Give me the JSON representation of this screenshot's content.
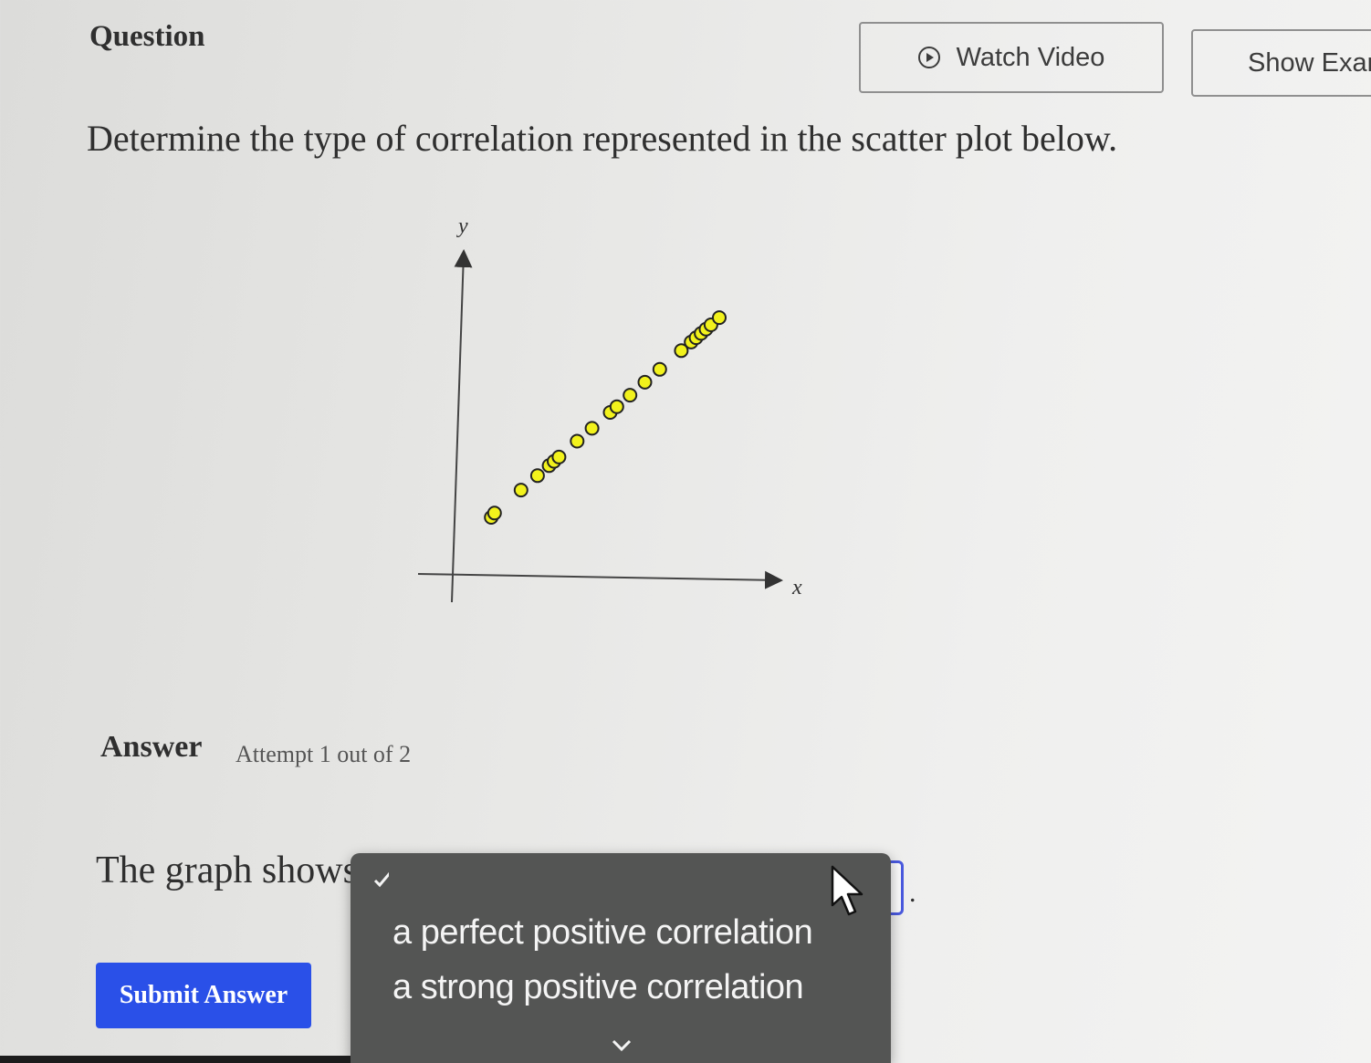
{
  "header": {
    "question_label": "Question",
    "watch_video_label": "Watch Video",
    "show_example_label": "Show Exar"
  },
  "question": {
    "prompt": "Determine the type of correlation represented in the scatter plot below."
  },
  "chart_data": {
    "type": "scatter",
    "xlabel": "x",
    "ylabel": "y",
    "xlim": [
      0,
      10
    ],
    "ylim": [
      0,
      10
    ],
    "grid": false,
    "point_color": "#f2f21c",
    "points": [
      {
        "x": 1.0,
        "y": 2.0
      },
      {
        "x": 1.1,
        "y": 2.15
      },
      {
        "x": 1.9,
        "y": 2.95
      },
      {
        "x": 2.4,
        "y": 3.45
      },
      {
        "x": 2.75,
        "y": 3.8
      },
      {
        "x": 2.9,
        "y": 3.95
      },
      {
        "x": 3.05,
        "y": 4.1
      },
      {
        "x": 3.6,
        "y": 4.65
      },
      {
        "x": 4.05,
        "y": 5.1
      },
      {
        "x": 4.6,
        "y": 5.65
      },
      {
        "x": 4.8,
        "y": 5.85
      },
      {
        "x": 5.2,
        "y": 6.25
      },
      {
        "x": 5.65,
        "y": 6.7
      },
      {
        "x": 6.1,
        "y": 7.15
      },
      {
        "x": 6.75,
        "y": 7.8
      },
      {
        "x": 7.05,
        "y": 8.1
      },
      {
        "x": 7.2,
        "y": 8.25
      },
      {
        "x": 7.35,
        "y": 8.4
      },
      {
        "x": 7.5,
        "y": 8.55
      },
      {
        "x": 7.65,
        "y": 8.7
      },
      {
        "x": 7.9,
        "y": 8.95
      }
    ]
  },
  "answer": {
    "label": "Answer",
    "attempt": "Attempt 1 out of 2",
    "sentence_start": "The graph shows",
    "period": ".",
    "options": [
      "a perfect positive correlation",
      "a strong positive correlation"
    ],
    "submit_label": "Submit Answer"
  },
  "colors": {
    "accent": "#2a50e8",
    "focus_border": "#4a5adf",
    "menu_background": "#545554"
  }
}
